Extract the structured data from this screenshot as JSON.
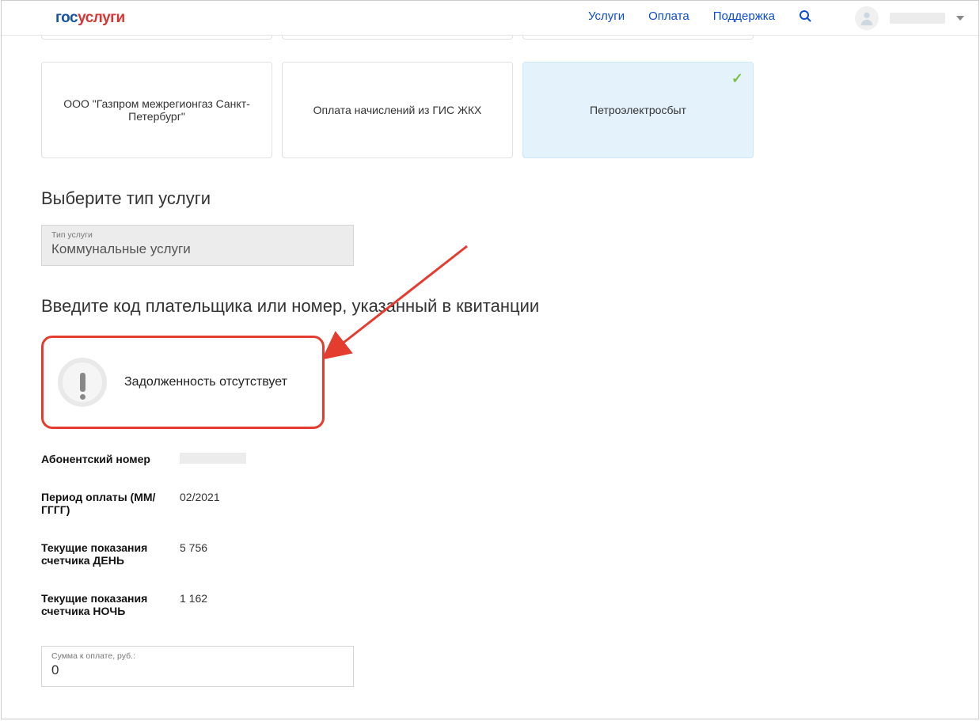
{
  "header": {
    "logo_prefix": "гос",
    "logo_suffix": "услуги",
    "nav": {
      "services": "Услуги",
      "payment": "Оплата",
      "support": "Поддержка"
    }
  },
  "cards": {
    "gazprom": "ООО \"Газпром межрегионгаз Санкт-Петербург\"",
    "gis": "Оплата начислений из ГИС ЖКХ",
    "pes": "Петроэлектросбыт"
  },
  "sections": {
    "service_type_heading": "Выберите тип услуги",
    "service_type_label": "Тип услуги",
    "service_type_value": "Коммунальные услуги",
    "payer_code_heading": "Введите код плательщика или номер, указанный в квитанции",
    "notice_text": "Задолженность отсутствует"
  },
  "details": {
    "subscriber_label": "Абонентский номер",
    "period_label": "Период оплаты (ММ/ГГГГ)",
    "period_value": "02/2021",
    "day_label": "Текущие показания счетчика ДЕНЬ",
    "day_value": "5 756",
    "night_label": "Текущие показания счетчика НОЧЬ",
    "night_value": "1 162"
  },
  "amount": {
    "label": "Сумма к оплате, руб.:",
    "value": "0"
  }
}
